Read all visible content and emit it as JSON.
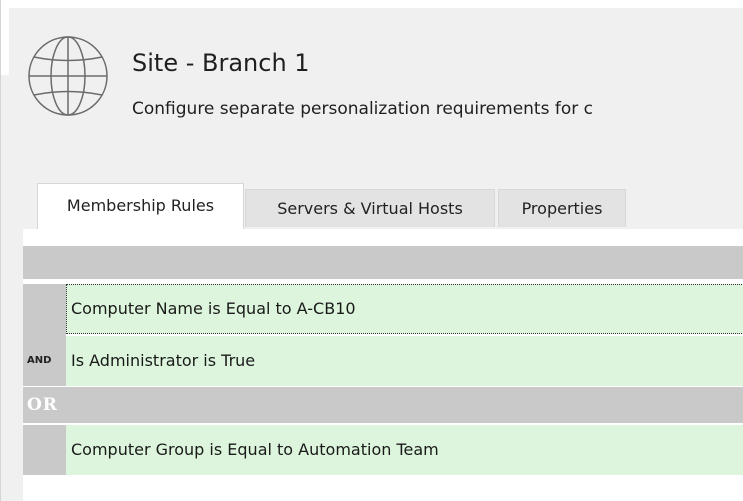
{
  "header": {
    "title": "Site - Branch 1",
    "subtitle": "Configure separate personalization requirements for c",
    "icon": "globe-icon"
  },
  "tabs": [
    {
      "label": "Membership Rules",
      "active": true
    },
    {
      "label": "Servers & Virtual Hosts",
      "active": false
    },
    {
      "label": "Properties",
      "active": false
    }
  ],
  "rules": {
    "group1": [
      {
        "text": "Computer Name is Equal to A-CB10",
        "operator": ""
      },
      {
        "text": "Is Administrator is True",
        "operator": "AND"
      }
    ],
    "or_label": "OR",
    "group2": [
      {
        "text": "Computer Group is Equal to Automation Team",
        "operator": ""
      }
    ]
  },
  "colors": {
    "rule_background": "#dcf5dc",
    "group_bar": "#c9c9c9",
    "tab_inactive": "#e3e3e3"
  }
}
